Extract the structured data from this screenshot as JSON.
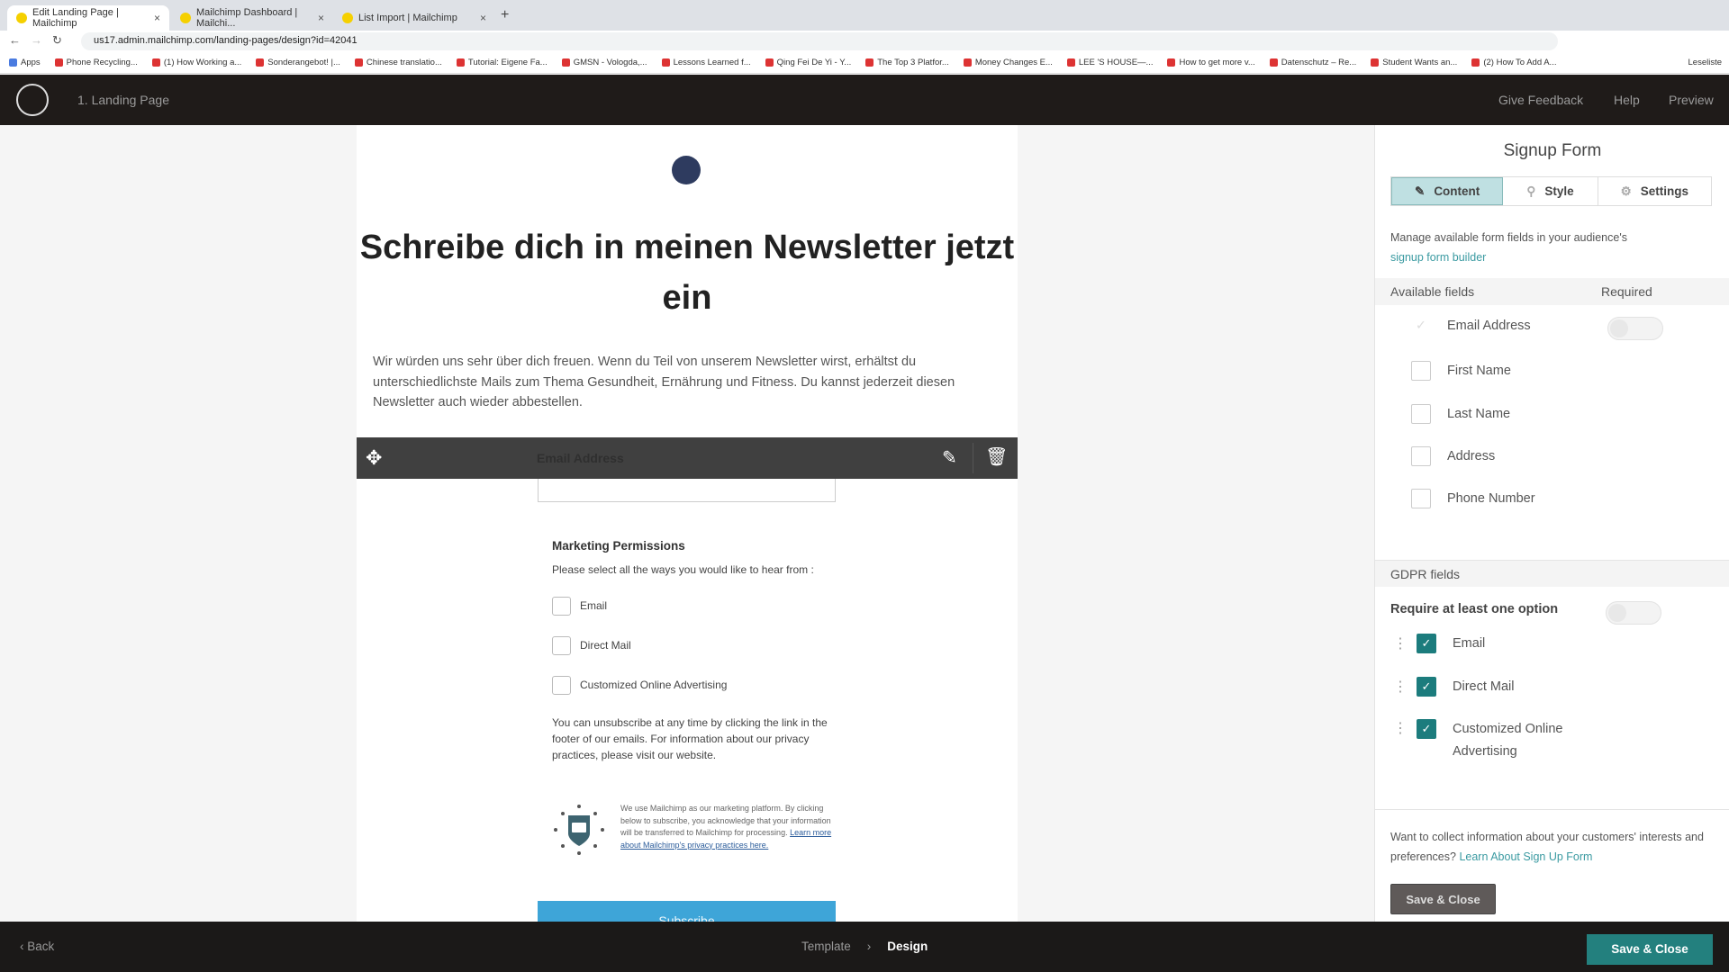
{
  "browser": {
    "tabs": [
      {
        "label": "Edit Landing Page | Mailchimp",
        "active": true
      },
      {
        "label": "Mailchimp Dashboard | Mailchi...",
        "active": false
      },
      {
        "label": "List Import | Mailchimp",
        "active": false
      }
    ],
    "url": "us17.admin.mailchimp.com/landing-pages/design?id=42041",
    "bookmarks": [
      "Apps",
      "Phone Recycling...",
      "(1) How Working a...",
      "Sonderangebot! |...",
      "Chinese translatio...",
      "Tutorial: Eigene Fa...",
      "GMSN - Vologda,...",
      "Lessons Learned f...",
      "Qing Fei De Yi - Y...",
      "The Top 3 Platfor...",
      "Money Changes E...",
      "LEE 'S HOUSE—...",
      "How to get more v...",
      "Datenschutz – Re...",
      "Student Wants an...",
      "(2) How To Add A..."
    ],
    "reading_list": "Leseliste"
  },
  "app": {
    "page_title": "1. Landing Page",
    "links": [
      "Give Feedback",
      "Help",
      "Preview"
    ]
  },
  "canvas": {
    "headline": "Schreibe dich in meinen Newsletter jetzt ein",
    "intro": "Wir würden uns sehr über dich freuen. Wenn du Teil von unserem Newsletter wirst, erhältst du unterschiedlichste Mails zum Thema Gesundheit, Ernährung und Fitness. Du kannst jederzeit diesen Newsletter auch wieder abbestellen.",
    "field_label": "Email Address",
    "mp_title": "Marketing Permissions",
    "mp_sub": "Please select all the ways you would like to hear from :",
    "mp_options": [
      "Email",
      "Direct Mail",
      "Customized Online Advertising"
    ],
    "unsub": "You can unsubscribe at any time by clicking the link in the footer of our emails. For information about our privacy practices, please visit our website.",
    "gdpr_text": "We use Mailchimp as our marketing platform. By clicking below to subscribe, you acknowledge that your information will be transferred to Mailchimp for processing.",
    "gdpr_link": "Learn more about Mailchimp's privacy practices here.",
    "subscribe": "Subscribe"
  },
  "panel": {
    "title": "Signup Form",
    "tabs": [
      "Content",
      "Style",
      "Settings"
    ],
    "manage_text": "Manage available form fields in your audience's",
    "manage_link": "signup form builder",
    "available_header": "Available fields",
    "required_header": "Required",
    "fields": [
      {
        "label": "Email Address",
        "checked": true,
        "disabled": true
      },
      {
        "label": "First Name",
        "checked": false
      },
      {
        "label": "Last Name",
        "checked": false
      },
      {
        "label": "Address",
        "checked": false
      },
      {
        "label": "Phone Number",
        "checked": false
      }
    ],
    "gdpr_header": "GDPR fields",
    "require_label": "Require at least one option",
    "require_on": false,
    "gdpr_options": [
      "Email",
      "Direct Mail",
      "Customized Online Advertising"
    ],
    "want_text": "Want to collect information about your customers' interests and preferences?",
    "want_link": "Learn About Sign Up Form",
    "save": "Save & Close",
    "accent": "#1c7c7d"
  },
  "footer": {
    "back": "Back",
    "crumbs": [
      "Template",
      "Design"
    ],
    "save": "Save & Close"
  }
}
